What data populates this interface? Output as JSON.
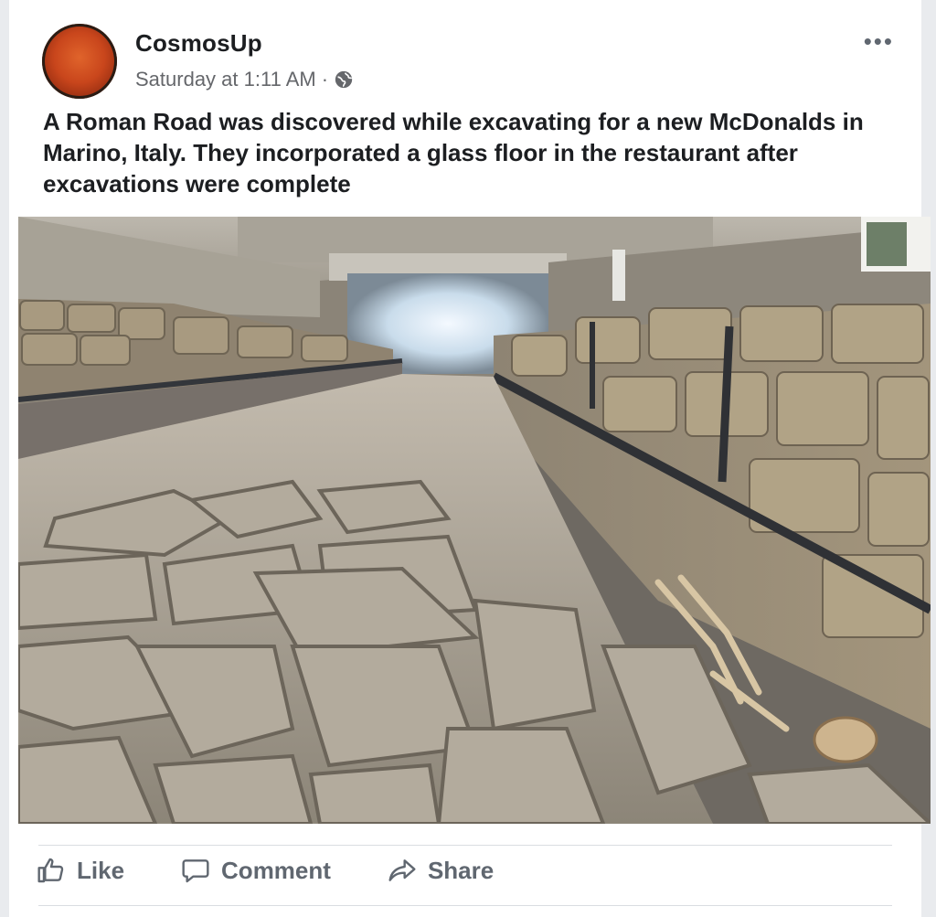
{
  "post": {
    "author": "CosmosUp",
    "timestamp": "Saturday at 1:11 AM",
    "separator": "·",
    "audience_icon": "globe-icon",
    "more_icon": "more-options-icon",
    "text": "A Roman Road was discovered while excavating for a new McDonalds in Marino, Italy. They incorporated a glass floor in the restaurant after excavations were complete"
  },
  "actions": {
    "like": "Like",
    "comment": "Comment",
    "share": "Share"
  },
  "colors": {
    "page_background": "#e9ebee",
    "card": "#ffffff",
    "secondary_text": "#65676b",
    "action_text": "#606770"
  }
}
